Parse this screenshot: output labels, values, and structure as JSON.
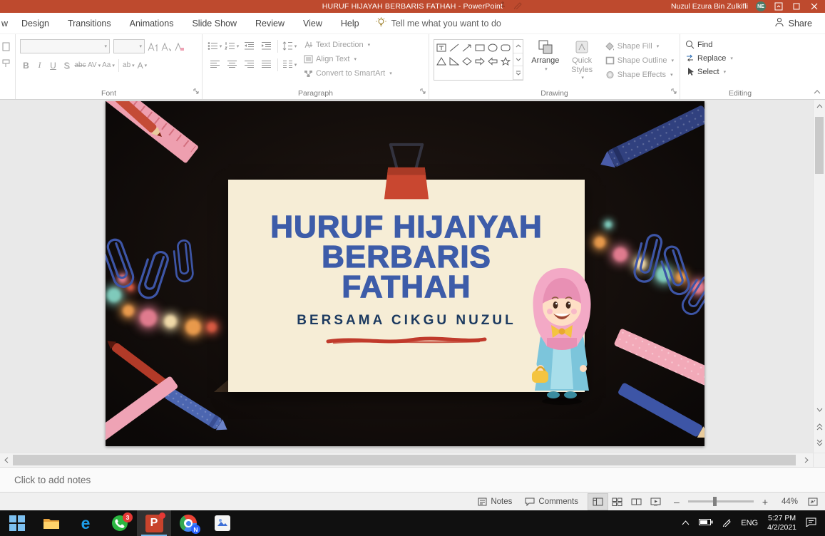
{
  "titlebar": {
    "title": "HURUF HIJAYAH BERBARIS FATHAH  -  PowerPoint",
    "user_name": "Nuzul Ezura Bin Zulkifli",
    "user_initials": "NE"
  },
  "tabs": {
    "partial": "w",
    "design": "Design",
    "transitions": "Transitions",
    "animations": "Animations",
    "slideshow": "Slide Show",
    "review": "Review",
    "view": "View",
    "help": "Help",
    "tellme": "Tell me what you want to do",
    "share": "Share"
  },
  "font_group": {
    "label": "Font",
    "bold": "B",
    "italic": "I",
    "underline": "U",
    "shadow": "S",
    "strike": "abc",
    "spacing": "AV",
    "case": "Aa",
    "highlight": "ab",
    "color": "A"
  },
  "paragraph_group": {
    "label": "Paragraph",
    "text_direction": "Text Direction",
    "align_text": "Align Text",
    "smartart": "Convert to SmartArt"
  },
  "drawing_group": {
    "label": "Drawing",
    "arrange": "Arrange",
    "quick": "Quick",
    "styles": "Styles",
    "shape_fill": "Shape Fill",
    "shape_outline": "Shape Outline",
    "shape_effects": "Shape Effects"
  },
  "editing_group": {
    "label": "Editing",
    "find": "Find",
    "replace": "Replace",
    "select": "Select"
  },
  "slide": {
    "title_line1": "HURUF HIJAIYAH",
    "title_line2": "BERBARIS",
    "title_line3": "FATHAH",
    "subtitle": "BERSAMA CIKGU NUZUL",
    "colors": {
      "background": "#191210",
      "paper": "#F6EDD6",
      "title_text": "#3D5CA9",
      "subtitle_text": "#1C3A60",
      "underline": "#C03A2B",
      "binder_clip": "#C94730",
      "paperclip": "#3D55A6"
    }
  },
  "notes_pane": {
    "placeholder": "Click to add notes"
  },
  "statusbar": {
    "notes": "Notes",
    "comments": "Comments",
    "zoom_out": "–",
    "zoom_in": "+",
    "zoom_level": "44%"
  },
  "taskbar": {
    "whatsapp_badge": "3",
    "chrome_badge": "N",
    "language": "ENG",
    "time": "5:27 PM",
    "date": "4/2/2021"
  },
  "icons_text": {
    "edge": "e",
    "powerpoint": "P"
  }
}
